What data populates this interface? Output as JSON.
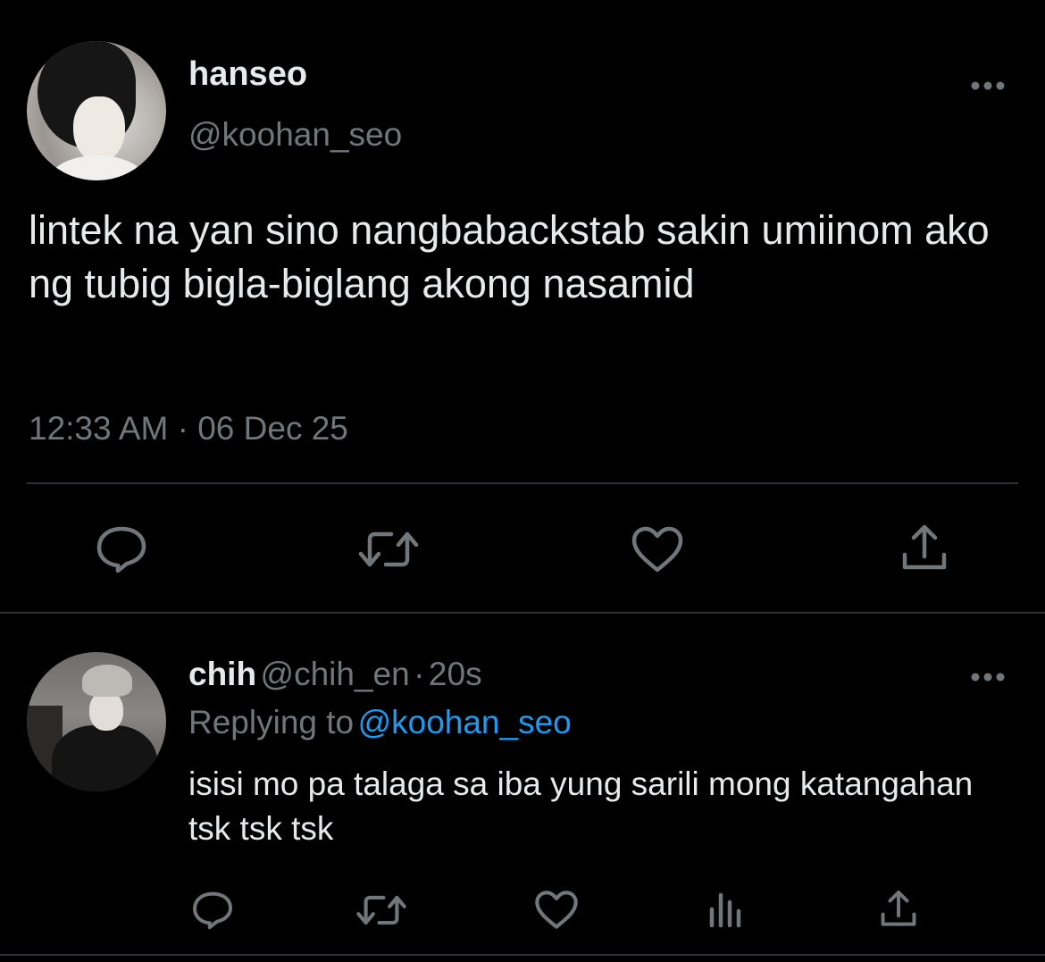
{
  "tweet": {
    "display_name": "hanseo",
    "handle": "@koohan_seo",
    "text": "lintek na yan sino nangbabackstab sakin umiinom ako ng tubig bigla-biglang akong nasamid",
    "timestamp": "12:33 AM · 06 Dec 25",
    "actions": [
      "reply-icon",
      "retweet-icon",
      "like-icon",
      "share-icon"
    ]
  },
  "reply": {
    "display_name": "chih",
    "handle": "@chih_en",
    "separator": "·",
    "age": "20s",
    "replying_to_label": "Replying to",
    "replying_to_handle": "@koohan_seo",
    "text": "isisi mo pa talaga sa iba yung sarili mong katangahan tsk tsk tsk",
    "actions": [
      "reply-icon",
      "retweet-icon",
      "like-icon",
      "analytics-icon",
      "share-icon"
    ]
  },
  "colors": {
    "background": "#000000",
    "primary_text": "#e7e9ea",
    "secondary_text": "#71767b",
    "link": "#1d9bf0",
    "divider": "#2f3336"
  }
}
